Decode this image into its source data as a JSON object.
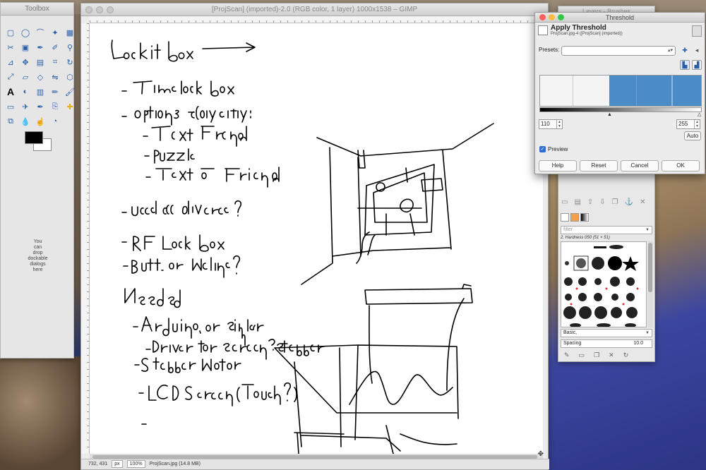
{
  "toolbox": {
    "title": "Toolbox",
    "drop_text": [
      "You",
      "can",
      "drop",
      "dockable",
      "dialogs",
      "here"
    ],
    "tools": [
      "rect-select-icon",
      "ellipse-select-icon",
      "free-select-icon",
      "fuzzy-select-icon",
      "color-select-icon",
      "scissors-select-icon",
      "foreground-select-icon",
      "paths-icon",
      "color-picker-icon",
      "zoom-icon",
      "measure-icon",
      "move-icon",
      "align-icon",
      "crop-icon",
      "rotate-icon",
      "scale-icon",
      "shear-icon",
      "perspective-icon",
      "flip-icon",
      "cage-icon",
      "text-icon",
      "bucket-fill-icon",
      "blend-icon",
      "pencil-icon",
      "paintbrush-icon",
      "eraser-icon",
      "airbrush-icon",
      "ink-icon",
      "clone-icon",
      "heal-icon",
      "perspective-clone-icon",
      "blur-icon",
      "smudge-icon",
      "dodge-burn-icon",
      ""
    ]
  },
  "image_window": {
    "title": "[ProjScan] (imported)-2.0 (RGB color, 1 layer) 1000x1538 – GIMP",
    "status": {
      "coords": "732, 431",
      "unit": "px",
      "zoom": "100%",
      "file": "ProjScan.jpg (14.8 MB)"
    }
  },
  "dialog": {
    "window_title": "Threshold",
    "title": "Apply Threshold",
    "subtitle": "ProjScan.jpg-4 ([ProjScan] (imported))",
    "presets_label": "Presets:",
    "low_value": "110",
    "high_value": "255",
    "auto_label": "Auto",
    "preview_label": "Preview",
    "buttons": {
      "help": "Help",
      "reset": "Reset",
      "cancel": "Cancel",
      "ok": "OK"
    }
  },
  "dock": {
    "title": "Layers - Brushes",
    "filter_placeholder": "filter",
    "brush_name": "2. Hardness 050 (51 × 51)",
    "brush_set": "Basic,",
    "spacing_label": "Spacing",
    "spacing_value": "10.0"
  }
}
